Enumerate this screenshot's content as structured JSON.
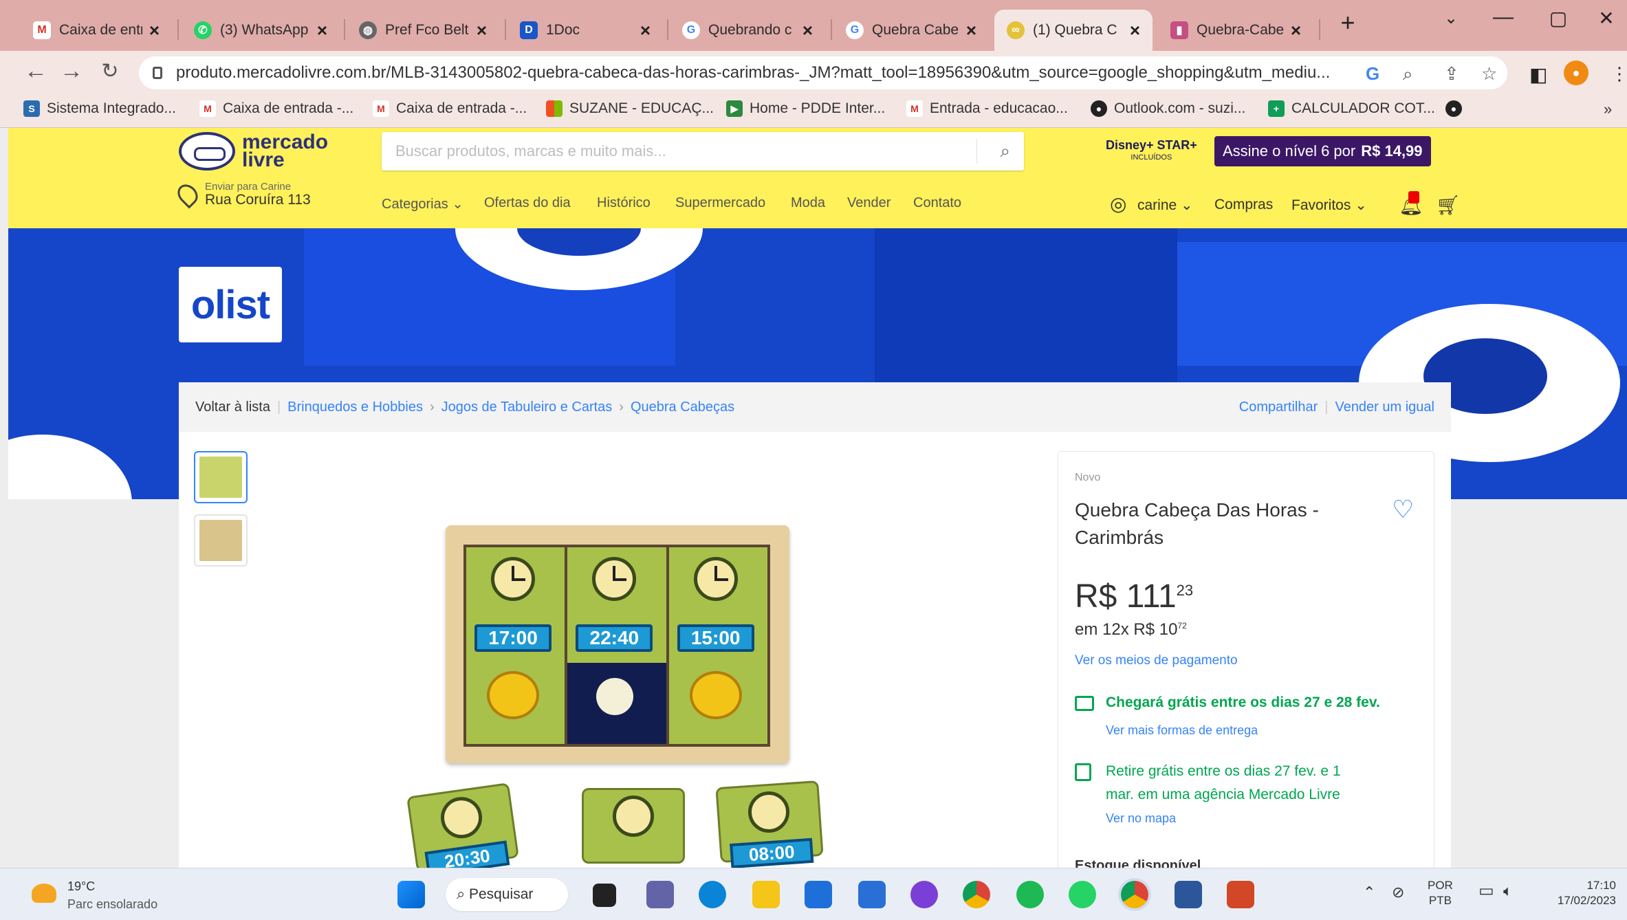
{
  "browser": {
    "tabs": [
      {
        "title": "Caixa de entr",
        "icon": "gmail-icon",
        "color": "#d93025"
      },
      {
        "title": "(3) WhatsApp",
        "icon": "whatsapp-icon",
        "color": "#25d366"
      },
      {
        "title": "Pref Fco Belt",
        "icon": "globe-icon",
        "color": "#555555"
      },
      {
        "title": "1Doc",
        "icon": "1doc-icon",
        "color": "#1a56c9"
      },
      {
        "title": "Quebrando c",
        "icon": "google-icon",
        "color": "#4285f4"
      },
      {
        "title": "Quebra Cabe",
        "icon": "google-icon",
        "color": "#4285f4"
      },
      {
        "title": "(1) Quebra C",
        "icon": "mercadolivre-icon",
        "color": "#e3c23a"
      },
      {
        "title": "Quebra-Cabe",
        "icon": "generic-site-icon",
        "color": "#c44f82"
      }
    ],
    "new_tab": "+",
    "window_controls": {
      "list": "⌄",
      "minimize": "—",
      "restore": "▢",
      "close": "✕"
    },
    "url": "produto.mercadolivre.com.br/MLB-3143005802-quebra-cabeca-das-horas-carimbras-_JM?matt_tool=18956390&utm_source=google_shopping&utm_mediu...",
    "bookmarks": [
      {
        "label": "Sistema Integrado...",
        "icon": "bookmark-icon",
        "color": "#2b6cb0"
      },
      {
        "label": "Caixa de entrada -...",
        "icon": "gmail-icon",
        "color": "#d93025"
      },
      {
        "label": "Caixa de entrada -...",
        "icon": "gmail-icon",
        "color": "#d93025"
      },
      {
        "label": "SUZANE - EDUCAÇ...",
        "icon": "microsoft-icon",
        "color": "#f25022"
      },
      {
        "label": "Home - PDDE Inter...",
        "icon": "pdde-icon",
        "color": "#2b8a3e"
      },
      {
        "label": "Entrada - educacao...",
        "icon": "gmail-icon",
        "color": "#d93025"
      },
      {
        "label": "Outlook.com - suzi...",
        "icon": "github-icon",
        "color": "#222222"
      },
      {
        "label": "CALCULADOR COT...",
        "icon": "sheets-icon",
        "color": "#0f9d58"
      }
    ],
    "bookmarks_more": "»"
  },
  "ml": {
    "logo_line1": "mercado",
    "logo_line2": "livre",
    "search_placeholder": "Buscar produtos, marcas e muito mais...",
    "address_label": "Enviar para Carine",
    "address": "Rua Coruíra 113",
    "nav": [
      "Categorias ⌄",
      "Ofertas do dia",
      "Histórico",
      "Supermercado",
      "Moda",
      "Vender",
      "Contato"
    ],
    "disney_line1": "Disney+ STAR+",
    "disney_line2": "INCLUÍDOS",
    "subscribe_text": "Assine o nível 6 por",
    "subscribe_price": "R$ 14,99",
    "user": "carine ⌄",
    "purchases": "Compras",
    "favorites": "Favoritos ⌄",
    "accent": "#fff159",
    "link_color": "#3483fa"
  },
  "banner": {
    "brand": "olist"
  },
  "breadcrumb": {
    "back": "Voltar à lista",
    "items": [
      "Brinquedos e Hobbies",
      "Jogos de Tabuleiro e Cartas",
      "Quebra Cabeças"
    ],
    "share": "Compartilhar",
    "sell_same": "Vender um igual"
  },
  "product": {
    "condition": "Novo",
    "title": "Quebra Cabeça Das Horas - Carimbrás",
    "price_int": "R$ 111",
    "price_cents": "23",
    "installments_text": "em 12x R$ 10",
    "installments_cents": "72",
    "payment_link": "Ver os meios de pagamento",
    "shipping_prefix": "Chegará grátis",
    "shipping_rest": "entre os dias 27 e 28 fev.",
    "shipping_link": "Ver mais formas de entrega",
    "pickup_prefix": "Retire grátis",
    "pickup_line1": "entre os dias 27 fev. e 1",
    "pickup_line2": "mar. em uma agência Mercado Livre",
    "map_link": "Ver no mapa",
    "stock_label": "Estoque disponível",
    "image_times": [
      "17:00",
      "22:40",
      "15:00"
    ],
    "piece_times": [
      "20:30",
      "08:00"
    ]
  },
  "taskbar": {
    "temp": "19°C",
    "weather": "Parc ensolarado",
    "search": "Pesquisar",
    "lang_top": "POR",
    "lang_bottom": "PTB",
    "time": "17:10",
    "date": "17/02/2023"
  }
}
